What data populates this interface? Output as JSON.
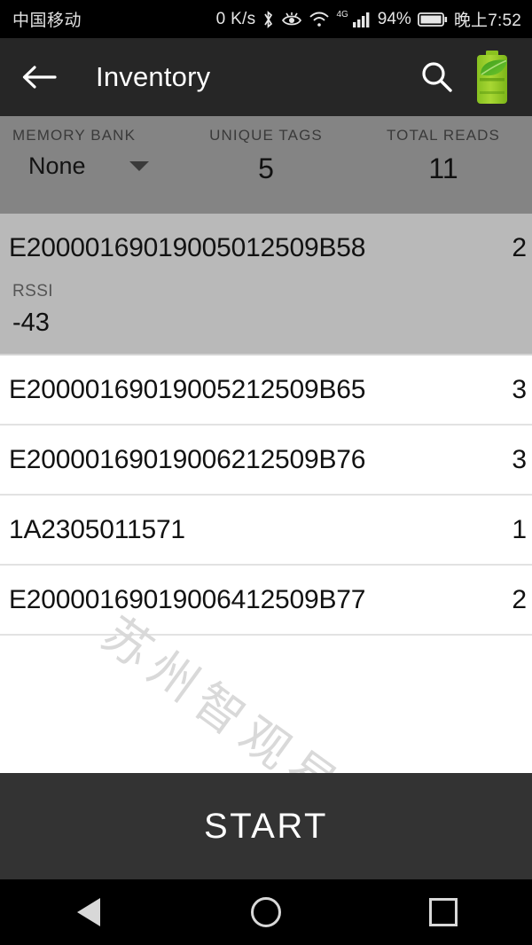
{
  "status_bar": {
    "carrier": "中国移动",
    "network_speed": "0 K/s",
    "bluetooth_icon": "bluetooth-icon",
    "eye_comfort_icon": "eye-icon",
    "wifi_icon": "wifi-icon",
    "network_type": "4G",
    "signal_icon": "signal-bars-icon",
    "battery_percent": "94%",
    "battery_icon": "battery-icon",
    "time": "晚上7:52"
  },
  "app_bar": {
    "back_icon": "back-arrow-icon",
    "title": "Inventory",
    "search_icon": "search-icon",
    "battery_eco_icon": "eco-battery-icon"
  },
  "stats": {
    "memory_bank": {
      "label": "MEMORY BANK",
      "value": "None",
      "caret_icon": "chevron-down-icon"
    },
    "unique_tags": {
      "label": "UNIQUE TAGS",
      "value": "5"
    },
    "total_reads": {
      "label": "TOTAL READS",
      "value": "11"
    }
  },
  "tag_list": {
    "rssi_label": "RSSI",
    "rows": [
      {
        "epc": "E20000169019005012509B58",
        "count": "2",
        "selected": true,
        "rssi": "-43"
      },
      {
        "epc": "E20000169019005212509B65",
        "count": "3",
        "selected": false
      },
      {
        "epc": "E20000169019006212509B76",
        "count": "3",
        "selected": false
      },
      {
        "epc": "1A2305011571",
        "count": "1",
        "selected": false
      },
      {
        "epc": "E20000169019006412509B77",
        "count": "2",
        "selected": false
      }
    ]
  },
  "watermark": {
    "text": "苏州智观易盛"
  },
  "start_button": {
    "label": "START"
  },
  "nav_bar": {
    "back_icon": "nav-back-icon",
    "home_icon": "nav-home-icon",
    "recents_icon": "nav-recents-icon"
  },
  "colors": {
    "app_bar_bg": "#262626",
    "stats_bg": "#848484",
    "selected_row_bg": "#b9b9b9",
    "start_bg": "#333333",
    "eco_green": "#8bc21f"
  }
}
